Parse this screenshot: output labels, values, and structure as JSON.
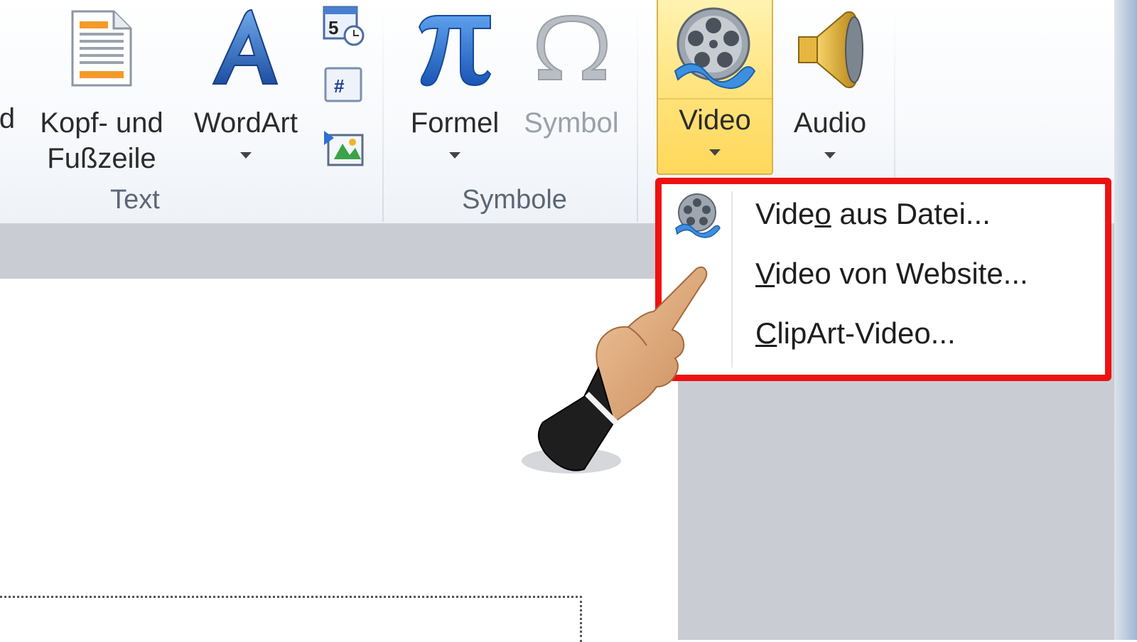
{
  "ribbon": {
    "groups": [
      {
        "label": "Text"
      },
      {
        "label": "Symbole"
      }
    ],
    "buttons": {
      "partial": {
        "label": "d"
      },
      "header_footer": {
        "line1": "Kopf- und",
        "line2": "Fußzeile"
      },
      "wordart": {
        "label": "WordArt"
      },
      "formula": {
        "label": "Formel"
      },
      "symbol": {
        "label": "Symbol"
      },
      "video": {
        "label": "Video"
      },
      "audio": {
        "label": "Audio"
      }
    },
    "small_icons": [
      "date-time-icon",
      "slide-number-icon",
      "object-icon"
    ]
  },
  "video_menu": {
    "items": [
      {
        "pre": "Vide",
        "accel": "o",
        "post": " aus Datei..."
      },
      {
        "pre": "",
        "accel": "V",
        "post": "ideo von Website..."
      },
      {
        "pre": "",
        "accel": "C",
        "post": "lipArt-Video..."
      }
    ],
    "highlight_color": "#ee1111"
  },
  "colors": {
    "video_button_bg": "#ffe27a",
    "ribbon_bg": "#f7f9fc",
    "workspace_gray": "#c9cdd3"
  }
}
